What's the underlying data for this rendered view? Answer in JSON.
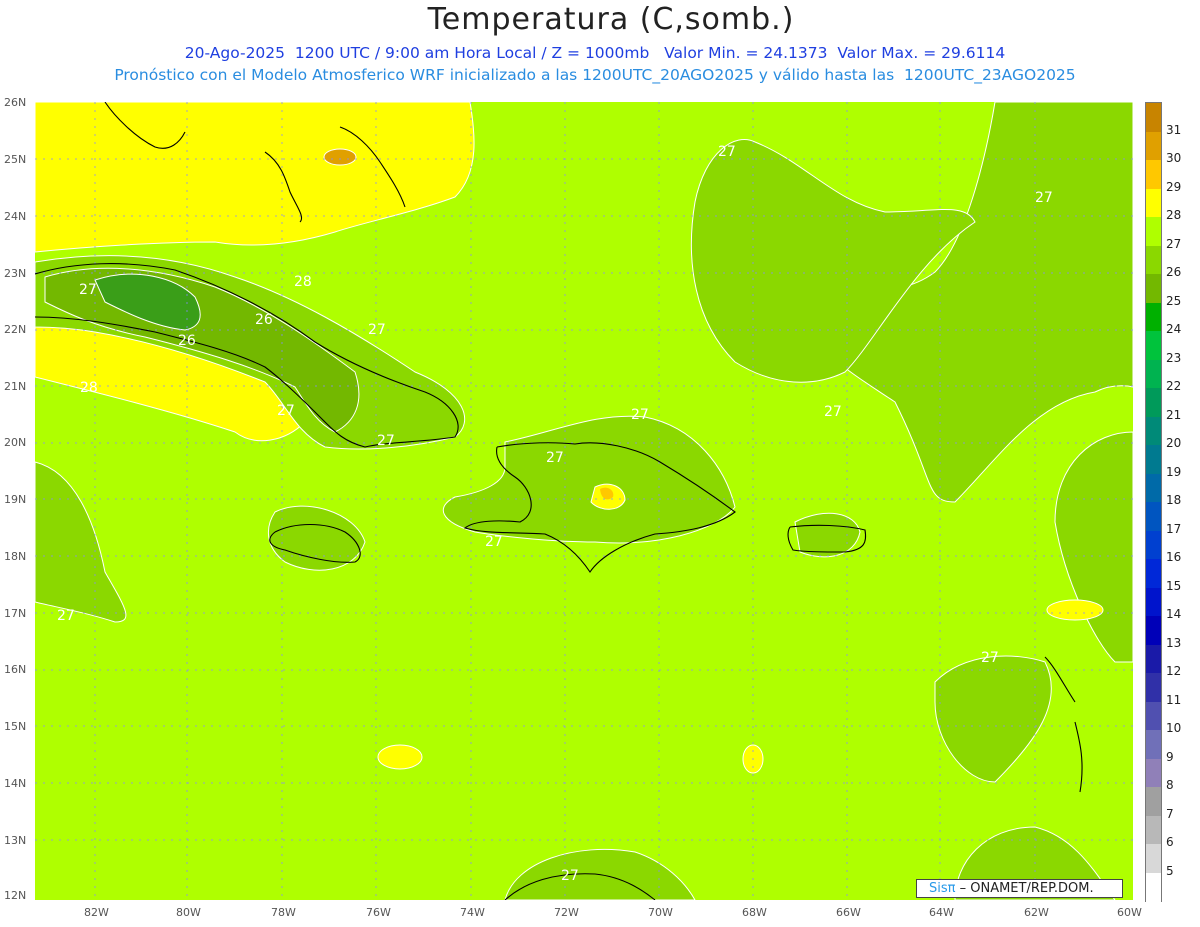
{
  "header": {
    "title": "Temperatura (C,somb.)",
    "subtitle_1": "20-Ago-2025  1200 UTC / 9:00 am Hora Local / Z = 1000mb   Valor Min. = 24.1373  Valor Max. = 29.6114",
    "subtitle_2": "Pronóstico con el Modelo Atmosferico WRF inicializado a las 1200UTC_20AGO2025 y válido hasta las  1200UTC_23AGO2025"
  },
  "map": {
    "lat_labels": [
      "26N",
      "25N",
      "24N",
      "23N",
      "22N",
      "21N",
      "20N",
      "19N",
      "18N",
      "17N",
      "16N",
      "15N",
      "14N",
      "13N",
      "12N"
    ],
    "lon_labels": [
      "82W",
      "80W",
      "78W",
      "76W",
      "74W",
      "72W",
      "70W",
      "68W",
      "66W",
      "64W",
      "62W",
      "60W"
    ],
    "contour_labels": [
      "27",
      "28",
      "27",
      "26",
      "26",
      "27",
      "28",
      "27",
      "27",
      "27",
      "27",
      "27",
      "27",
      "27",
      "27",
      "27",
      "27"
    ],
    "background_color": "#afff00",
    "field_colors": {
      "t26_27": "#8bd800",
      "t25_26": "#73b800",
      "t24_25": "#3a9e18",
      "t28_29": "#ffff00",
      "t29_30": "#ffc800",
      "t30_31": "#e0a000"
    }
  },
  "colorbar": {
    "labels": [
      "31",
      "30",
      "29",
      "28",
      "27",
      "26",
      "25",
      "24",
      "23",
      "22",
      "21",
      "20",
      "19",
      "18",
      "17",
      "16",
      "15",
      "14",
      "13",
      "12",
      "11",
      "10",
      "9",
      "8",
      "7",
      "6",
      "5"
    ],
    "colors": [
      "#c88400",
      "#e0a000",
      "#ffc800",
      "#ffff00",
      "#afff00",
      "#8bd800",
      "#73b800",
      "#00b000",
      "#00c33c",
      "#00b350",
      "#009a5a",
      "#008a78",
      "#007a90",
      "#006aa8",
      "#0055c0",
      "#0040d0",
      "#0028d8",
      "#0014cc",
      "#0000b8",
      "#1a1aa8",
      "#3030a8",
      "#5050b0",
      "#7070b8",
      "#9080b8",
      "#a0a0a0",
      "#b8b8b8",
      "#d8d8d8",
      "#ffffff"
    ]
  },
  "credit": {
    "brand": "Sisπ",
    "text": "– ONAMET/REP.DOM."
  }
}
